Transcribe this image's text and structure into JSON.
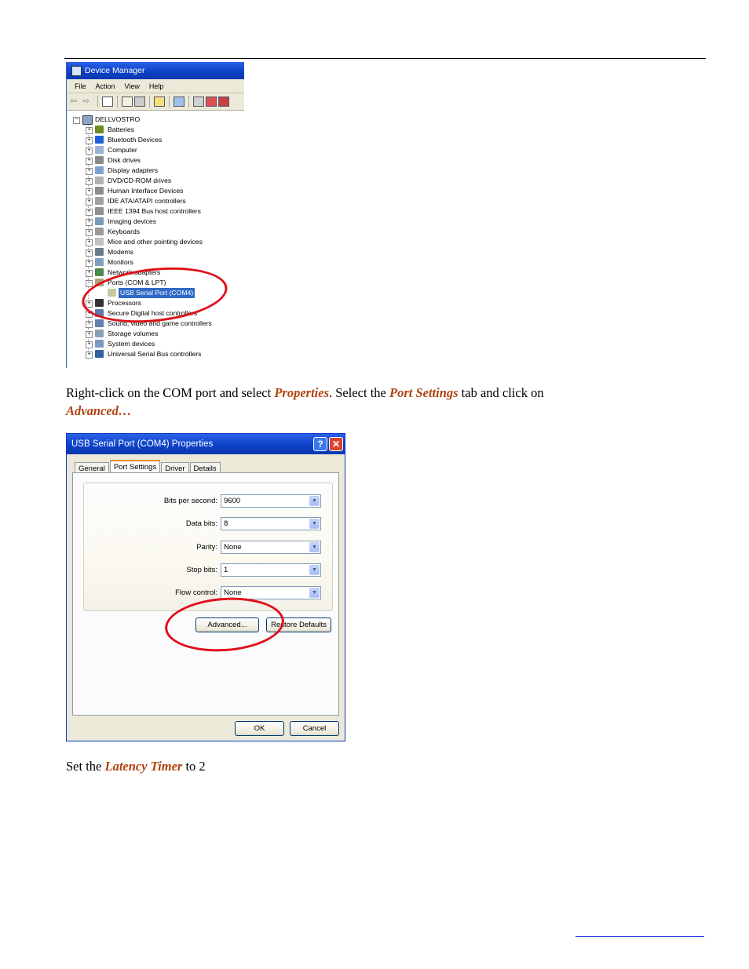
{
  "device_manager": {
    "title": "Device Manager",
    "menu": [
      "File",
      "Action",
      "View",
      "Help"
    ],
    "root": "DELLVOSTRO",
    "items": [
      "Batteries",
      "Bluetooth Devices",
      "Computer",
      "Disk drives",
      "Display adapters",
      "DVD/CD-ROM drives",
      "Human Interface Devices",
      "IDE ATA/ATAPI controllers",
      "IEEE 1394 Bus host controllers",
      "Imaging devices",
      "Keyboards",
      "Mice and other pointing devices",
      "Modems",
      "Monitors",
      "Network adapters",
      "Ports (COM & LPT)",
      "USB Serial Port (COM4)",
      "Processors",
      "Secure Digital host controllers",
      "Sound, video and game controllers",
      "Storage volumes",
      "System devices",
      "Universal Serial Bus controllers"
    ]
  },
  "instruction1": {
    "prefix": "Right-click on the COM port and select ",
    "properties": "Properties",
    "middle": ". Select the ",
    "port_settings": "Port Settings",
    "suffix": " tab and click on",
    "advanced": "Advanced…"
  },
  "properties_dialog": {
    "title": "USB Serial Port (COM4) Properties",
    "help_glyph": "?",
    "close_glyph": "✕",
    "tabs": [
      "General",
      "Port Settings",
      "Driver",
      "Details"
    ],
    "fields": [
      {
        "label": "Bits per second:",
        "value": "9600"
      },
      {
        "label": "Data bits:",
        "value": "8"
      },
      {
        "label": "Parity:",
        "value": "None"
      },
      {
        "label": "Stop bits:",
        "value": "1"
      },
      {
        "label": "Flow control:",
        "value": "None"
      }
    ],
    "advanced_button": "Advanced...",
    "restore_button": "Restore Defaults",
    "ok_button": "OK",
    "cancel_button": "Cancel"
  },
  "instruction2": {
    "prefix": "Set the ",
    "latency": "Latency Timer",
    "suffix": " to 2"
  },
  "colors": {
    "highlight_text": "#b1420e",
    "annotation_circle": "#e0101a",
    "titlebar": "#0b3fc4"
  }
}
